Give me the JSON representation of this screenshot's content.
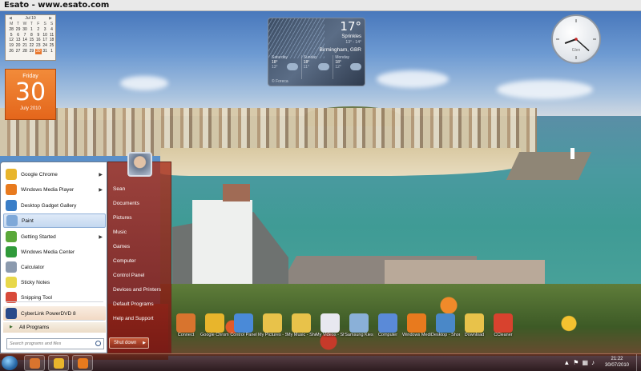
{
  "window": {
    "title": "Esato - www.esato.com"
  },
  "calendar": {
    "month_label": "Jul 10",
    "weekdays": [
      "M",
      "T",
      "W",
      "T",
      "F",
      "S",
      "S"
    ],
    "weeks": [
      [
        "28",
        "29",
        "30",
        "1",
        "2",
        "3",
        "4"
      ],
      [
        "5",
        "6",
        "7",
        "8",
        "9",
        "10",
        "11"
      ],
      [
        "12",
        "13",
        "14",
        "15",
        "16",
        "17",
        "18"
      ],
      [
        "19",
        "20",
        "21",
        "22",
        "23",
        "24",
        "25"
      ],
      [
        "26",
        "27",
        "28",
        "29",
        "30",
        "31",
        "1"
      ]
    ],
    "selected_day": "30",
    "big": {
      "weekday": "Friday",
      "day": "30",
      "month_year": "July 2010"
    }
  },
  "weather": {
    "temperature": "17°",
    "condition": "Sprinkles",
    "range": "13° - 14°",
    "location": "Birmingham, GBR",
    "forecast": [
      {
        "day": "Saturday",
        "high": "18°",
        "low": "13°"
      },
      {
        "day": "Sunday",
        "high": "18°",
        "low": "11°"
      },
      {
        "day": "Monday",
        "high": "18°",
        "low": "12°"
      }
    ],
    "brand": "© Foreca"
  },
  "clock": {
    "label": "Glen",
    "hour_angle": 250,
    "minute_angle": 132
  },
  "start_menu": {
    "programs": [
      {
        "label": "Google Chrome",
        "icon": "chrome-icon",
        "color": "#e8b52c",
        "arrow": true
      },
      {
        "label": "Windows Media Player",
        "icon": "media-player-icon",
        "color": "#e87a1e",
        "arrow": true
      },
      {
        "label": "Desktop Gadget Gallery",
        "icon": "gadget-gallery-icon",
        "color": "#3a7ec8",
        "arrow": false
      },
      {
        "label": "Paint",
        "icon": "paint-icon",
        "color": "#7ea8d8",
        "arrow": false,
        "selected": true
      },
      {
        "label": "Getting Started",
        "icon": "getting-started-icon",
        "color": "#5aa83a",
        "arrow": true
      },
      {
        "label": "Windows Media Center",
        "icon": "media-center-icon",
        "color": "#2f9a3a",
        "arrow": false
      },
      {
        "label": "Calculator",
        "icon": "calculator-icon",
        "color": "#8b9aae",
        "arrow": false
      },
      {
        "label": "Sticky Notes",
        "icon": "sticky-notes-icon",
        "color": "#e8d84a",
        "arrow": false
      },
      {
        "label": "Snipping Tool",
        "icon": "snipping-tool-icon",
        "color": "#d84a3a",
        "arrow": false
      },
      {
        "label": "CyberLink PowerDVD 8",
        "icon": "powerdvd-icon",
        "color": "#2a4a8a",
        "arrow": false
      }
    ],
    "all_programs": "All Programs",
    "search_placeholder": "Search programs and files",
    "links": [
      "Sean",
      "Documents",
      "Pictures",
      "Music",
      "Games",
      "Computer",
      "Control Panel",
      "Devices and Printers",
      "Default Programs",
      "Help and Support"
    ],
    "shutdown": "Shut down"
  },
  "desktop_icons": [
    {
      "label": "Connect",
      "icon": "connect-icon",
      "color": "#d8742e"
    },
    {
      "label": "Google Chrome",
      "icon": "chrome-icon",
      "color": "#e8b52c"
    },
    {
      "label": "Control Panel",
      "icon": "control-panel-icon",
      "color": "#4a8ad8"
    },
    {
      "label": "My Pictures - Shortcut",
      "icon": "pictures-folder-icon",
      "color": "#e8c24a"
    },
    {
      "label": "My Music - Shortcut",
      "icon": "music-folder-icon",
      "color": "#e8c24a"
    },
    {
      "label": "My Videos - Shortcut",
      "icon": "videos-folder-icon",
      "color": "#e8e8f0"
    },
    {
      "label": "Samsung Kies",
      "icon": "kies-icon",
      "color": "#8ab0d8"
    },
    {
      "label": "Computer",
      "icon": "computer-icon",
      "color": "#5a8ad8"
    },
    {
      "label": "Windows Media Player",
      "icon": "media-player-icon",
      "color": "#e87a1e"
    },
    {
      "label": "Desktop - Shortcut",
      "icon": "desktop-shortcut-icon",
      "color": "#4a88c8"
    },
    {
      "label": "Download",
      "icon": "download-folder-icon",
      "color": "#e8c24a"
    },
    {
      "label": "CCleaner",
      "icon": "ccleaner-icon",
      "color": "#d8422e"
    }
  ],
  "taskbar": {
    "pinned": [
      {
        "icon": "kies-taskbar-icon",
        "color": "#d8742e"
      },
      {
        "icon": "chrome-taskbar-icon",
        "color": "#e8b52c"
      },
      {
        "icon": "media-player-taskbar-icon",
        "color": "#e87a1e"
      }
    ],
    "time": "21:22",
    "date": "30/07/2010"
  }
}
